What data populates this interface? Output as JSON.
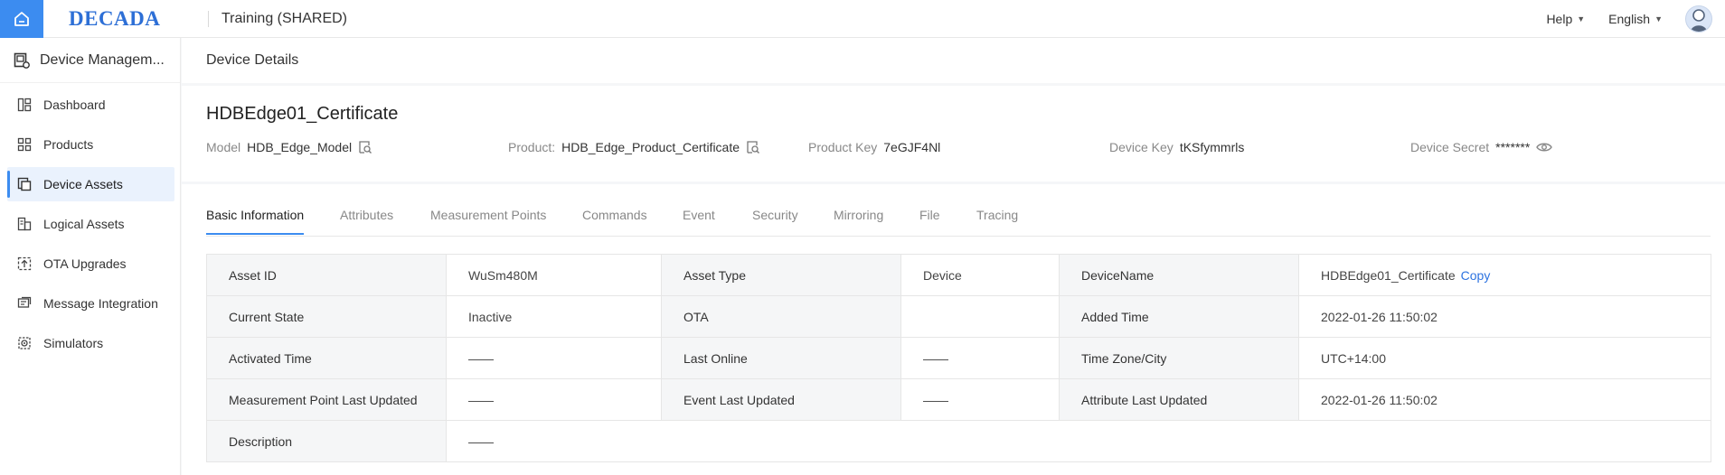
{
  "topbar": {
    "logo": "DECADA",
    "workspace": "Training (SHARED)",
    "help_label": "Help",
    "language_label": "English"
  },
  "sidebar": {
    "title": "Device Managem...",
    "items": [
      {
        "label": "Dashboard",
        "icon": "dashboard-icon"
      },
      {
        "label": "Products",
        "icon": "products-icon"
      },
      {
        "label": "Device Assets",
        "icon": "device-assets-icon",
        "active": true
      },
      {
        "label": "Logical Assets",
        "icon": "logical-assets-icon"
      },
      {
        "label": "OTA Upgrades",
        "icon": "ota-upgrades-icon"
      },
      {
        "label": "Message Integration",
        "icon": "message-integration-icon"
      },
      {
        "label": "Simulators",
        "icon": "simulators-icon"
      }
    ]
  },
  "page": {
    "title": "Device Details"
  },
  "device": {
    "name": "HDBEdge01_Certificate",
    "model_label": "Model",
    "model_value": "HDB_Edge_Model",
    "product_label": "Product:",
    "product_value": "HDB_Edge_Product_Certificate",
    "product_key_label": "Product Key",
    "product_key_value": "7eGJF4Nl",
    "device_key_label": "Device Key",
    "device_key_value": "tKSfymmrls",
    "device_secret_label": "Device Secret",
    "device_secret_value": "*******"
  },
  "tabs": [
    {
      "label": "Basic Information",
      "active": true
    },
    {
      "label": "Attributes"
    },
    {
      "label": "Measurement Points"
    },
    {
      "label": "Commands"
    },
    {
      "label": "Event"
    },
    {
      "label": "Security"
    },
    {
      "label": "Mirroring"
    },
    {
      "label": "File"
    },
    {
      "label": "Tracing"
    }
  ],
  "basic_info": {
    "rows": [
      [
        {
          "label": "Asset ID",
          "value": "WuSm480M"
        },
        {
          "label": "Asset Type",
          "value": "Device"
        },
        {
          "label": "DeviceName",
          "value": "HDBEdge01_Certificate"
        }
      ],
      [
        {
          "label": "Current State",
          "value": "Inactive"
        },
        {
          "label": "OTA",
          "value": ""
        },
        {
          "label": "Added Time",
          "value": "2022-01-26 11:50:02"
        }
      ],
      [
        {
          "label": "Activated Time",
          "value": "——"
        },
        {
          "label": "Last Online",
          "value": "——"
        },
        {
          "label": "Time Zone/City",
          "value": "UTC+14:00"
        }
      ],
      [
        {
          "label": "Measurement Point Last Updated",
          "value": "——"
        },
        {
          "label": "Event Last Updated",
          "value": "——"
        },
        {
          "label": "Attribute Last Updated",
          "value": "2022-01-26 11:50:02"
        }
      ]
    ],
    "description_label": "Description",
    "description_value": "——",
    "copy_label": "Copy"
  },
  "colors": {
    "accent": "#3c8cf0",
    "logo": "#2d6fd6",
    "link": "#2d73e0",
    "active_bg": "#eaf2fd"
  }
}
